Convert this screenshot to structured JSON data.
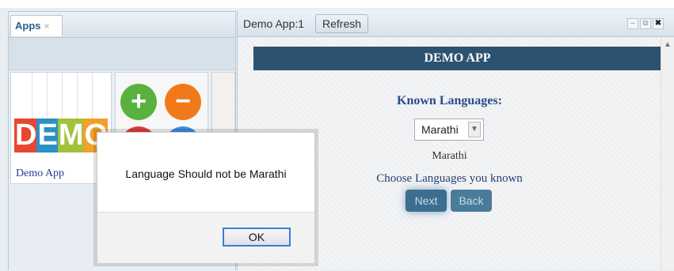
{
  "left_panel": {
    "tab_label": "Apps",
    "tab_close": "×",
    "apps": [
      {
        "label": "Demo App",
        "logo_letters": [
          "D",
          "E",
          "M",
          "O"
        ],
        "logo_colors": [
          "#e8462f",
          "#2a90c6",
          "#a1c23a",
          "#f0a12b"
        ]
      }
    ],
    "tile2_colors": {
      "plus": "#59b23f",
      "minus": "#f07a1a",
      "times": "#e23b3b",
      "info": "#3a8ee0"
    }
  },
  "right_panel": {
    "window_title": "Demo App:1",
    "refresh_label": "Refresh",
    "controls": {
      "minimize": "–",
      "restore": "⧉",
      "close": "✖"
    },
    "header": "DEMO APP",
    "known_label": "Known Languages:",
    "select_value": "Marathi",
    "selected_text": "Marathi",
    "choose_label": "Choose Languages you known",
    "next_label": "Next",
    "back_label": "Back"
  },
  "dialog": {
    "message": "Language Should not be Marathi",
    "ok_label": "OK"
  },
  "colors": {
    "header_bg": "#2c5271",
    "button_bg": "#3c6f8f",
    "ok_focus": "#3b7dd8"
  }
}
